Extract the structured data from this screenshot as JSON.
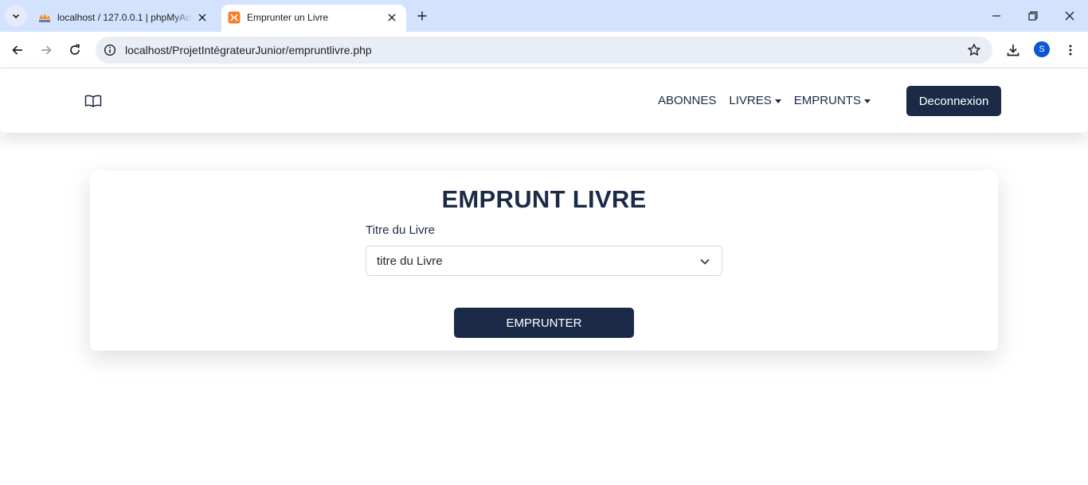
{
  "browser": {
    "tabs": [
      {
        "title": "localhost / 127.0.0.1 | phpMyAdmin",
        "favicon": "phpmyadmin-icon",
        "active": false
      },
      {
        "title": "Emprunter un Livre",
        "favicon": "xampp-icon",
        "active": true
      }
    ],
    "url": "localhost/ProjetIntégrateurJunior/empruntlivre.php",
    "profile_initial": "S"
  },
  "navbar": {
    "logo_icon": "open-book-icon",
    "links": [
      {
        "label": "ABONNES",
        "dropdown": false
      },
      {
        "label": "LIVRES",
        "dropdown": true
      },
      {
        "label": "EMPRUNTS",
        "dropdown": true
      }
    ],
    "logout_label": "Deconnexion"
  },
  "form": {
    "title": "EMPRUNT LIVRE",
    "book_label": "Titre du Livre",
    "book_selected": "titre du Livre",
    "submit_label": "EMPRUNTER"
  },
  "colors": {
    "primary": "#1b2a47",
    "tabstrip": "#d3e3fd",
    "omnibox": "#e9eef6"
  }
}
